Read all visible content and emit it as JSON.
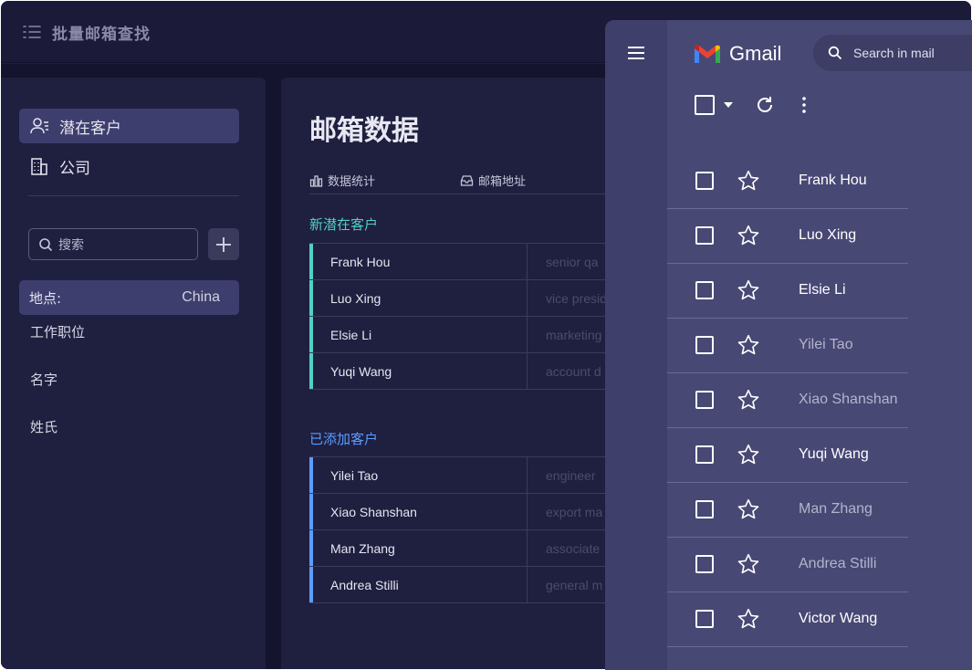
{
  "app": {
    "title": "批量邮箱查找"
  },
  "sidebar": {
    "items": [
      {
        "label": "潜在客户",
        "icon": "contacts-icon",
        "active": true
      },
      {
        "label": "公司",
        "icon": "building-icon",
        "active": false
      }
    ],
    "search_placeholder": "搜索",
    "filter": {
      "label": "地点:",
      "value": "China"
    },
    "filter_fields": [
      "工作职位",
      "名字",
      "姓氏"
    ]
  },
  "main": {
    "title": "邮箱数据",
    "tabs": [
      {
        "label": "数据统计",
        "icon": "chart-icon"
      },
      {
        "label": "邮箱地址",
        "icon": "inbox-icon"
      }
    ],
    "new_leads": {
      "title": "新潜在客户",
      "accent": "#4fd1c5",
      "rows": [
        {
          "name": "Frank Hou",
          "title": "senior qa"
        },
        {
          "name": "Luo Xing",
          "title": "vice presid"
        },
        {
          "name": "Elsie Li",
          "title": "marketing"
        },
        {
          "name": "Yuqi Wang",
          "title": "account d"
        }
      ]
    },
    "added_leads": {
      "title": "已添加客户",
      "accent": "#5b9dff",
      "rows": [
        {
          "name": "Yilei Tao",
          "title": "engineer"
        },
        {
          "name": "Xiao Shanshan",
          "title": "export ma"
        },
        {
          "name": "Man Zhang",
          "title": "associate"
        },
        {
          "name": "Andrea Stilli",
          "title": "general m"
        }
      ]
    }
  },
  "gmail": {
    "logo_text": "Gmail",
    "search_placeholder": "Search in mail",
    "emails": [
      {
        "sender": "Frank Hou",
        "unread": true
      },
      {
        "sender": "Luo Xing",
        "unread": true
      },
      {
        "sender": "Elsie Li",
        "unread": true
      },
      {
        "sender": "Yilei Tao",
        "unread": false
      },
      {
        "sender": "Xiao Shanshan",
        "unread": false
      },
      {
        "sender": "Yuqi Wang",
        "unread": true
      },
      {
        "sender": "Man Zhang",
        "unread": false
      },
      {
        "sender": "Andrea Stilli",
        "unread": false
      },
      {
        "sender": "Victor Wang",
        "unread": true
      }
    ]
  }
}
